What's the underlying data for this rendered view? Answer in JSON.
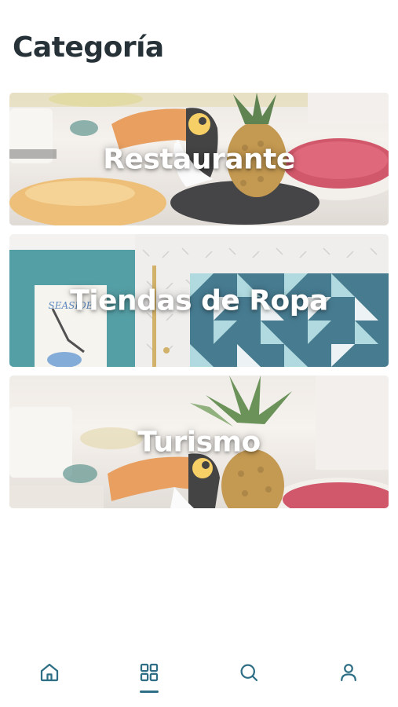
{
  "header": {
    "title": "Categoría"
  },
  "categories": [
    {
      "label": "Restaurante"
    },
    {
      "label": "Tiendas de Ropa"
    },
    {
      "label": "Turismo"
    }
  ],
  "nav": {
    "items": [
      {
        "icon": "home-icon",
        "active": false
      },
      {
        "icon": "grid-icon",
        "active": true
      },
      {
        "icon": "search-icon",
        "active": false
      },
      {
        "icon": "user-icon",
        "active": false
      }
    ],
    "icon_color": "#2e6f86"
  }
}
